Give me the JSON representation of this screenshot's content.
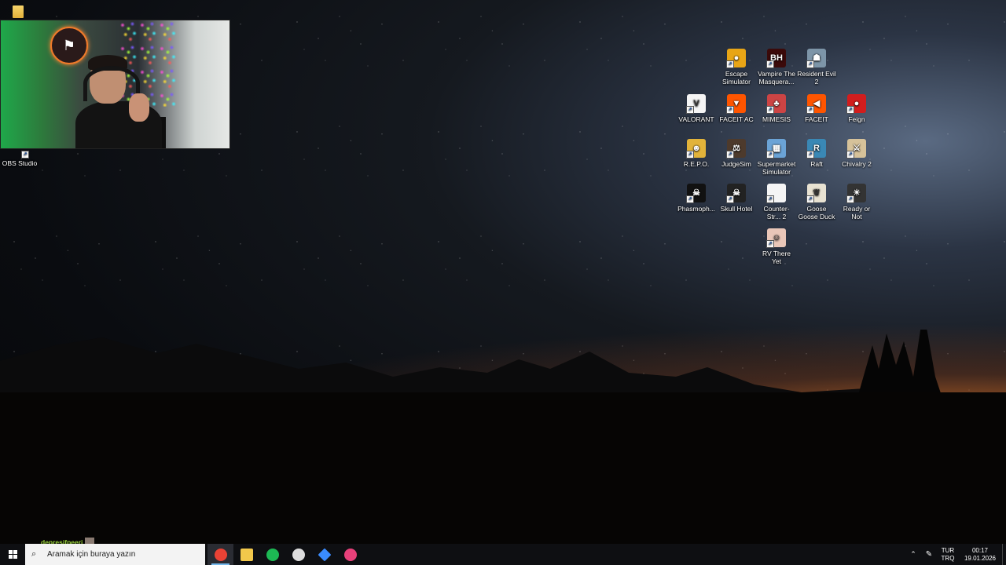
{
  "desktop": {
    "obs_label": "OBS Studio",
    "icons": [
      {
        "label": "Escape Simulator",
        "icon": "keyhole-icon",
        "bg": "#e8a516",
        "glyph": "●"
      },
      {
        "label": "Vampire The Masquera...",
        "icon": "bloodhunt-icon",
        "bg": "#3b0a0a",
        "glyph": "BH"
      },
      {
        "label": "Resident Evil 2",
        "icon": "re2-icon",
        "bg": "#7d95a8",
        "glyph": "☗"
      },
      {
        "label": "VALORANT",
        "icon": "valorant-icon",
        "bg": "#f5f5f5",
        "glyph": "V"
      },
      {
        "label": "FACEIT AC",
        "icon": "faceit-ac-icon",
        "bg": "#ff5500",
        "glyph": "▼"
      },
      {
        "label": "MIMESIS",
        "icon": "mimesis-icon",
        "bg": "#c44",
        "glyph": "♣"
      },
      {
        "label": "FACEIT",
        "icon": "faceit-icon",
        "bg": "#ff5500",
        "glyph": "◀"
      },
      {
        "label": "Feign",
        "icon": "feign-icon",
        "bg": "#d21d1d",
        "glyph": "●"
      },
      {
        "label": "R.E.P.O.",
        "icon": "repo-icon",
        "bg": "#e2b33a",
        "glyph": "☻"
      },
      {
        "label": "JudgeSim",
        "icon": "judgesim-icon",
        "bg": "#4d3a2c",
        "glyph": "⚖"
      },
      {
        "label": "Supermarket Simulator",
        "icon": "supermarket-icon",
        "bg": "#6ba3d6",
        "glyph": "▦"
      },
      {
        "label": "Raft",
        "icon": "raft-icon",
        "bg": "#3a88b5",
        "glyph": "R"
      },
      {
        "label": "Chivalry 2",
        "icon": "chivalry-icon",
        "bg": "#d6c29a",
        "glyph": "⚔"
      },
      {
        "label": "Phasmoph...",
        "icon": "phasmophobia-icon",
        "bg": "#111",
        "glyph": "☠"
      },
      {
        "label": "Skull Hotel",
        "icon": "skull-hotel-icon",
        "bg": "#222",
        "glyph": "☠"
      },
      {
        "label": "Counter-Str... 2",
        "icon": "file-icon",
        "bg": "#f5f5f5",
        "glyph": ""
      },
      {
        "label": "Goose Goose Duck",
        "icon": "goose-icon",
        "bg": "#e8e2d2",
        "glyph": "❦"
      },
      {
        "label": "Ready or Not",
        "icon": "ready-or-not-icon",
        "bg": "#333",
        "glyph": "☀"
      },
      {
        "label": "RV There Yet",
        "icon": "rv-icon",
        "bg": "#e9c6b8",
        "glyph": "☺"
      }
    ]
  },
  "chat": {
    "username": "depresifpeeri"
  },
  "taskbar": {
    "search_placeholder": "Aramak için buraya yazın",
    "apps": [
      {
        "name": "chrome-icon",
        "color": "#e94235",
        "active": true
      },
      {
        "name": "file-explorer-icon",
        "color": "#f2c84b",
        "active": false
      },
      {
        "name": "spotify-icon",
        "color": "#1db954",
        "active": false
      },
      {
        "name": "obs-icon",
        "color": "#dddddd",
        "active": false
      },
      {
        "name": "app-diamond-icon",
        "color": "#3a8cff",
        "active": false
      },
      {
        "name": "discord-icon",
        "color": "#e8417a",
        "active": false
      }
    ],
    "tray": {
      "lang_line1": "TUR",
      "lang_line2": "TRQ",
      "time": "00:17",
      "date": "19.01.2026"
    }
  }
}
